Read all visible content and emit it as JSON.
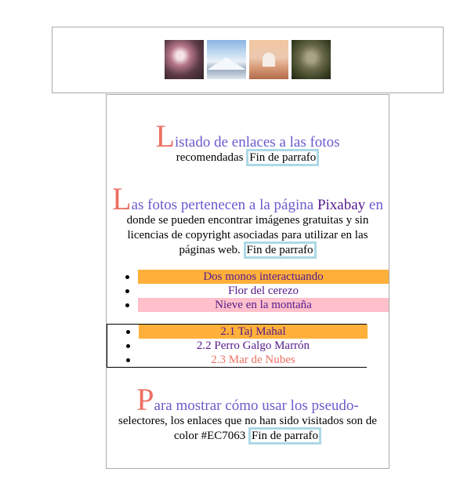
{
  "gallery": {
    "images": [
      {
        "name": "cherry-blossom-photo"
      },
      {
        "name": "snowy-mountain-photo"
      },
      {
        "name": "taj-mahal-photo"
      },
      {
        "name": "monkeys-photo"
      }
    ]
  },
  "section1": {
    "cap": "L",
    "heading_rest": "istado de enlaces a las fotos",
    "line2": "recomendadas",
    "end": "Fin de parrafo"
  },
  "section2": {
    "cap": "L",
    "heading_rest": "as fotos pertenecen a la página ",
    "link": "Pixabay",
    "heading_after": " en",
    "body": "donde se pueden encontrar imágenes gratuitas y sin licencias de copyright asociadas para utilizar en las páginas web.",
    "end": "Fin de parrafo"
  },
  "list1": {
    "items": [
      {
        "label": "Dos monos interactuando",
        "bg": "#FFB03B",
        "color": "#551a8b"
      },
      {
        "label": "Flor del cerezo",
        "bg": "#ffffff",
        "color": "#551a8b"
      },
      {
        "label": "Nieve en la montaña",
        "bg": "#FFC0CB",
        "color": "#551a8b"
      }
    ]
  },
  "list2": {
    "items": [
      {
        "label": "2.1 Taj Mahal",
        "bg": "#FFB03B",
        "color": "#551a8b"
      },
      {
        "label": "2.2 Perro Galgo Marrón",
        "bg": "#ffffff",
        "color": "#551a8b"
      },
      {
        "label": "2.3 Mar de Nubes",
        "bg": "#ffffff",
        "color": "#EC7063"
      }
    ]
  },
  "section3": {
    "cap": "P",
    "heading_rest": "ara mostrar cómo usar los pseudo-",
    "body": "selectores, los enlaces que no han sido visitados son de color #EC7063",
    "end": "Fin de parrafo"
  },
  "colors": {
    "accent": "#EC7063",
    "heading": "#6a5acd",
    "visited": "#551a8b",
    "end_border": "#add8e6"
  }
}
